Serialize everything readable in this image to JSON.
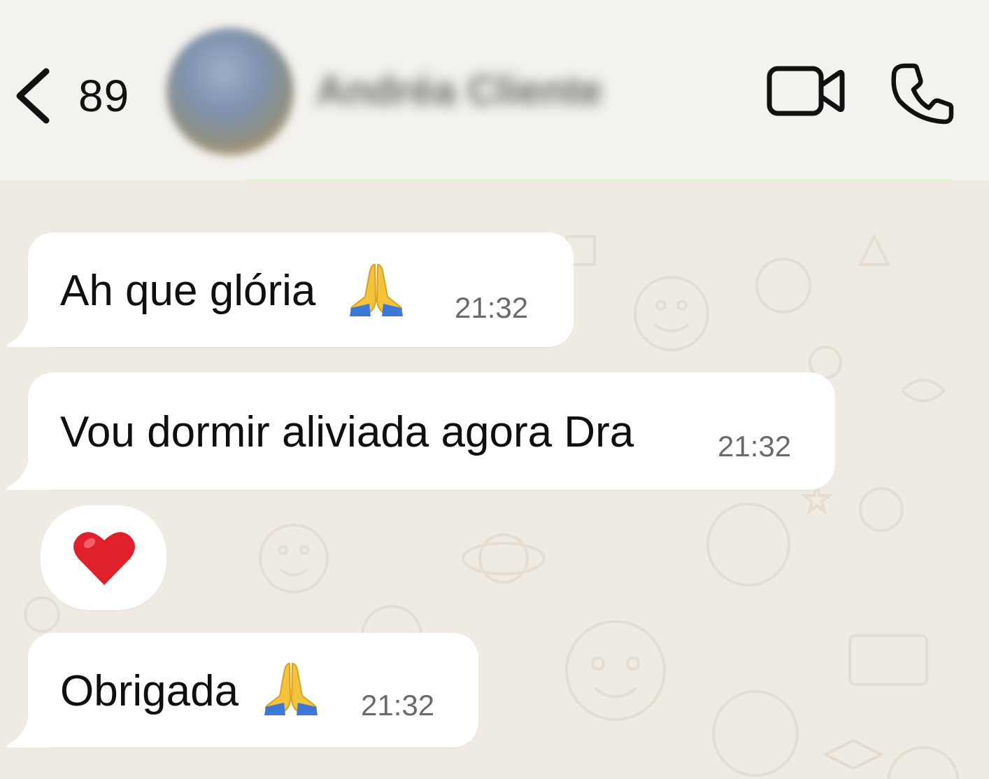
{
  "header": {
    "back_count": "89",
    "contact_name": "Andréa Cliente",
    "video_call_icon": "video-camera-icon",
    "voice_call_icon": "phone-icon",
    "back_icon": "chevron-left-icon"
  },
  "messages": [
    {
      "text": "Ah que glória",
      "emoji": "folded-hands",
      "time": "21:32"
    },
    {
      "text": "Vou dormir aliviada agora Dra",
      "time": "21:32"
    },
    {
      "emoji": "red-heart"
    },
    {
      "text": "Obrigada",
      "emoji": "folded-hands",
      "time": "21:32"
    }
  ],
  "colors": {
    "header_bg": "#f4f2ee",
    "chat_bg": "#efeae2",
    "bubble_bg": "#ffffff",
    "time_text": "#6b6b6b",
    "heart": "#e0202a"
  }
}
